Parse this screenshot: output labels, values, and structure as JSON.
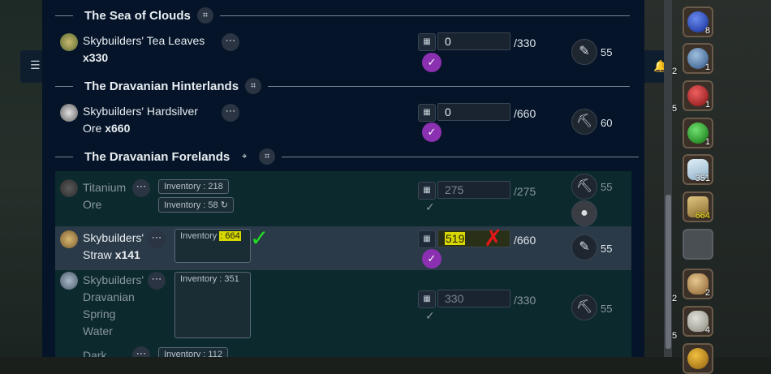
{
  "sections": [
    {
      "title": "The Sea of Clouds"
    },
    {
      "title": "The Dravanian Hinterlands"
    },
    {
      "title": "The Dravanian Forelands"
    }
  ],
  "items": [
    {
      "name": "Skybuilders' Tea Leaves",
      "qty_label": "x330",
      "value": "0",
      "total": "/330",
      "level": "55",
      "tool": "feather-icon"
    },
    {
      "name": "Skybuilders' Hardsilver",
      "name2": "Ore",
      "qty_label": "x660",
      "value": "0",
      "total": "/660",
      "level": "60",
      "tool": "pickaxe-icon"
    },
    {
      "name": "Titanium",
      "name2": "Ore",
      "inv1": "Inventory : 218",
      "inv2": "Inventory : 58",
      "value": "275",
      "total": "/275",
      "level": "55",
      "tool": "pickaxe-icon"
    },
    {
      "name": "Skybuilders'",
      "name2": "Straw",
      "qty_label": "x141",
      "inv_label": "Inventory ",
      "inv_highlight": ": 664",
      "value": "519",
      "total": "/660",
      "level": "55",
      "tool": "feather-icon"
    },
    {
      "name": "Skybuilders'",
      "name2": "Dravanian",
      "name3": "Spring",
      "name4": "Water",
      "inv1": "Inventory : 351",
      "value": "330",
      "total": "/330",
      "level": "55",
      "tool": "pickaxe-icon"
    },
    {
      "name": "Dark",
      "inv1": "Inventory : 112"
    }
  ],
  "inventory_slots": [
    {
      "count": "8"
    },
    {
      "count": "1"
    },
    {
      "count": "1"
    },
    {
      "count": "1"
    },
    {
      "count": "351"
    },
    {
      "count": "664"
    },
    {
      "count": ""
    },
    {
      "count": "2"
    },
    {
      "count": "4"
    }
  ],
  "left_counts": [
    "2",
    "5",
    "2",
    "5"
  ],
  "colors": {
    "panel": "#051428",
    "done_row": "#0c2a2e",
    "selected_row": "#2a3a48",
    "check": "#8a30b0",
    "highlight": "#d8d800"
  }
}
